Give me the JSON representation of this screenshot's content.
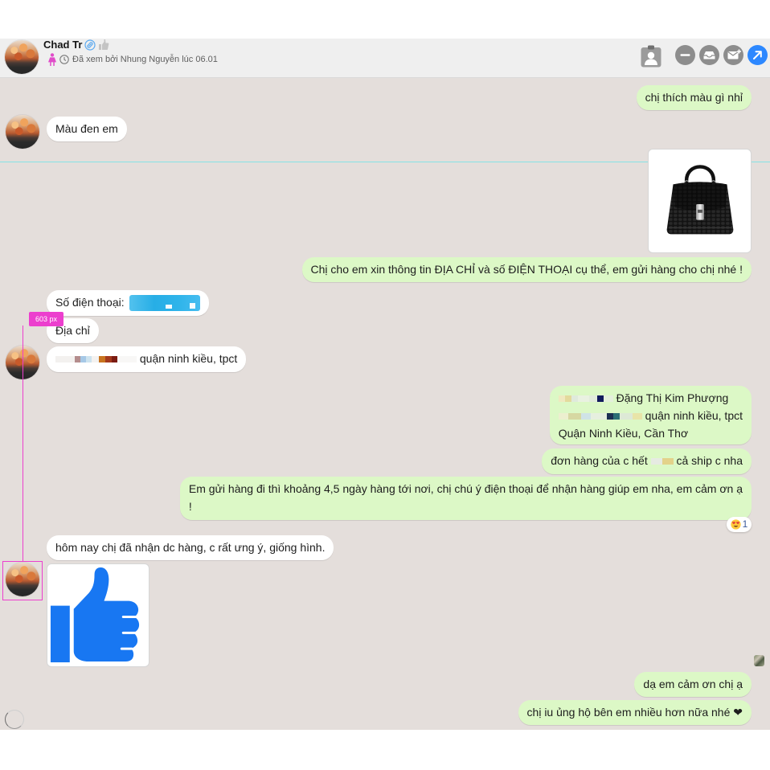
{
  "colors": {
    "chat_background": "#e4dedb",
    "outgoing_bubble": "#dcf8c6",
    "incoming_bubble": "#ffffff",
    "accent_blue": "#2d88ff",
    "measure_overlay": "#ec3fce",
    "guide_line": "#86e3e6"
  },
  "header": {
    "contact_name": "Chad Tr",
    "name_icons": [
      "link-icon",
      "like-icon"
    ],
    "seen_status": "Đã xem bởi Nhung Nguyễn lúc 06.01",
    "status_icons": [
      "female-icon",
      "clock-icon"
    ],
    "actions": [
      "contact-card-icon",
      "minus-icon",
      "inbox-icon",
      "envelope-icon",
      "arrow-up-right-icon"
    ]
  },
  "messages": [
    {
      "sent": true,
      "text": "chị thích màu gì nhỉ"
    },
    {
      "sent": false,
      "text": "Màu đen em"
    },
    {
      "sent": true,
      "image_icon": "black-handbag-image"
    },
    {
      "sent": true,
      "text": "Chị cho em xin thông tin ĐỊA CHỈ và số ĐIỆN THOẠI cụ thể, em gửi hàng cho chị nhé !"
    },
    {
      "sent": false,
      "text": "Số điện thoại:",
      "redacted_value": true
    },
    {
      "sent": false,
      "text": "Địa chỉ"
    },
    {
      "sent": false,
      "text": "quận ninh kiều, tpct",
      "redacted_prefix": true
    },
    {
      "sent": true,
      "lines": [
        "Đặng Thị Kim Phượng",
        "quận ninh kiều, tpct",
        "Quận Ninh Kiều, Cần Thơ"
      ],
      "redacted_prefix": true
    },
    {
      "sent": true,
      "text_before": "đơn hàng của c hết",
      "text_after": "cả ship c nha",
      "redacted_middle": true
    },
    {
      "sent": true,
      "lines": [
        "Em gửi hàng đi thì khoảng 4,5 ngày hàng tới nơi, chị chú ý điện thoại để nhận hàng giúp em nha, em cảm ơn ạ",
        "!"
      ],
      "reaction": {
        "emoji_icon": "heart-eyes-emoji-icon",
        "count": 1
      }
    },
    {
      "sent": false,
      "text": "hôm nay chị đã nhận dc hàng, c rất ưng ý, giống hình."
    },
    {
      "sent": false,
      "image_icon": "thumbs-up-like-image"
    },
    {
      "sent": true,
      "text": "dạ em cảm ơn chị ạ"
    },
    {
      "sent": true,
      "text": "chị iu ủng hộ bên em nhiều hơn nữa nhé ❤"
    }
  ],
  "overlay": {
    "measure_label": "603 px"
  }
}
